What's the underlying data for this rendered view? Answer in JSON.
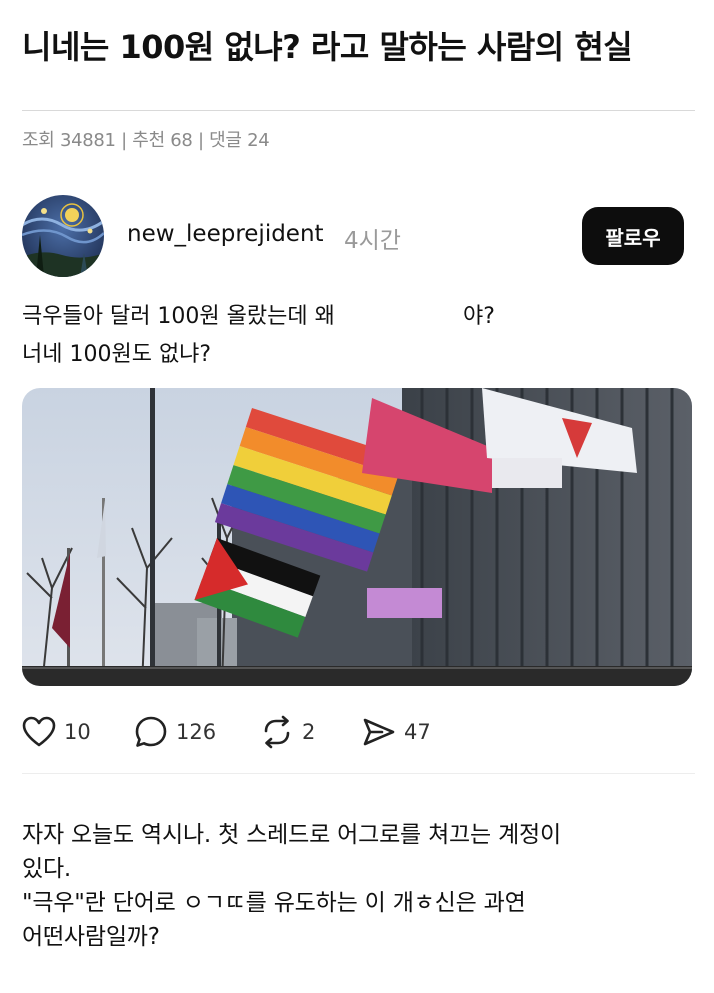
{
  "article": {
    "title": "니네는 100원 없냐? 라고 말하는 사람의 현실",
    "meta": "조회 34881 | 추천 68 | 댓글 24"
  },
  "post": {
    "username": "new_leeprejident",
    "time": "4시간",
    "follow_label": "팔로우",
    "text_line1": "극우들아 달러 100원 올랐는데 왜",
    "text_line1_tail": "야?",
    "text_line2": "너네 100원도 없냐?",
    "image_icon": "photo-flags-rally",
    "actions": {
      "likes": "10",
      "comments": "126",
      "reposts": "2",
      "shares": "47"
    }
  },
  "body": {
    "line1": "자자 오늘도 역시나. 첫 스레드로 어그로를 쳐끄는 계정이",
    "line2": "있다.",
    "line3": "\"극우\"란 단어로 ㅇㄱㄸ를 유도하는 이 개ㅎ신은 과연",
    "line4": "어떤사람일까?"
  },
  "colors": {
    "follow_button": "#0d0d0d",
    "meta_text": "#8a8a8a",
    "divider": "#d9d9d9"
  }
}
